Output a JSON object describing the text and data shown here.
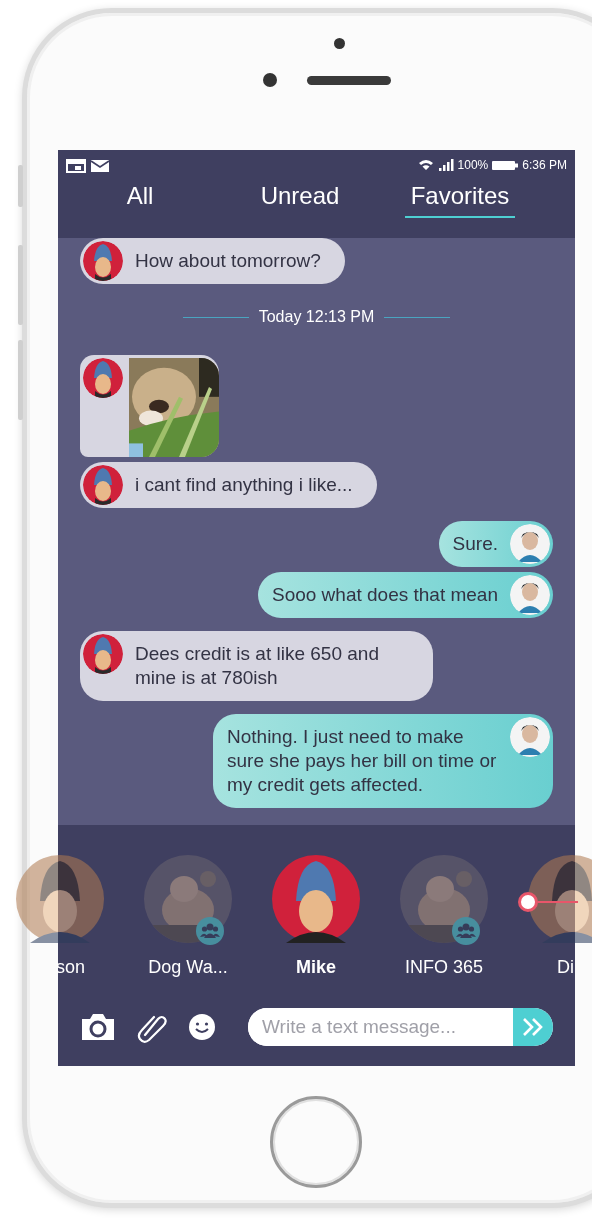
{
  "status_bar": {
    "battery": "100%",
    "time": "6:36 PM"
  },
  "tabs": [
    {
      "label": "All",
      "selected": false
    },
    {
      "label": "Unread",
      "selected": false
    },
    {
      "label": "Favorites",
      "selected": true
    }
  ],
  "messages": [
    {
      "kind": "incoming",
      "text": "How about tomorrow?"
    },
    {
      "kind": "divider",
      "text": "Today 12:13 PM"
    },
    {
      "kind": "incoming_photo"
    },
    {
      "kind": "incoming",
      "text": "i cant find anything i like..."
    },
    {
      "kind": "outgoing",
      "text": "Sure."
    },
    {
      "kind": "outgoing",
      "text": "Sooo what does that mean"
    },
    {
      "kind": "incoming",
      "text": "Dees credit is at like 650 and mine is at 780ish"
    },
    {
      "kind": "outgoing",
      "text": "Nothing. I just need to make sure she pays her bill on time or my credit gets affected."
    }
  ],
  "contacts": [
    {
      "name": "son",
      "selected": false,
      "group": false,
      "kind": "left"
    },
    {
      "name": "Dog Wa...",
      "selected": false,
      "group": true,
      "kind": "full"
    },
    {
      "name": "Mike",
      "selected": true,
      "group": false,
      "kind": "full"
    },
    {
      "name": "INFO 365",
      "selected": false,
      "group": true,
      "kind": "full"
    },
    {
      "name": "Di",
      "selected": false,
      "group": false,
      "kind": "right"
    }
  ],
  "composer": {
    "placeholder": "Write a text message..."
  }
}
